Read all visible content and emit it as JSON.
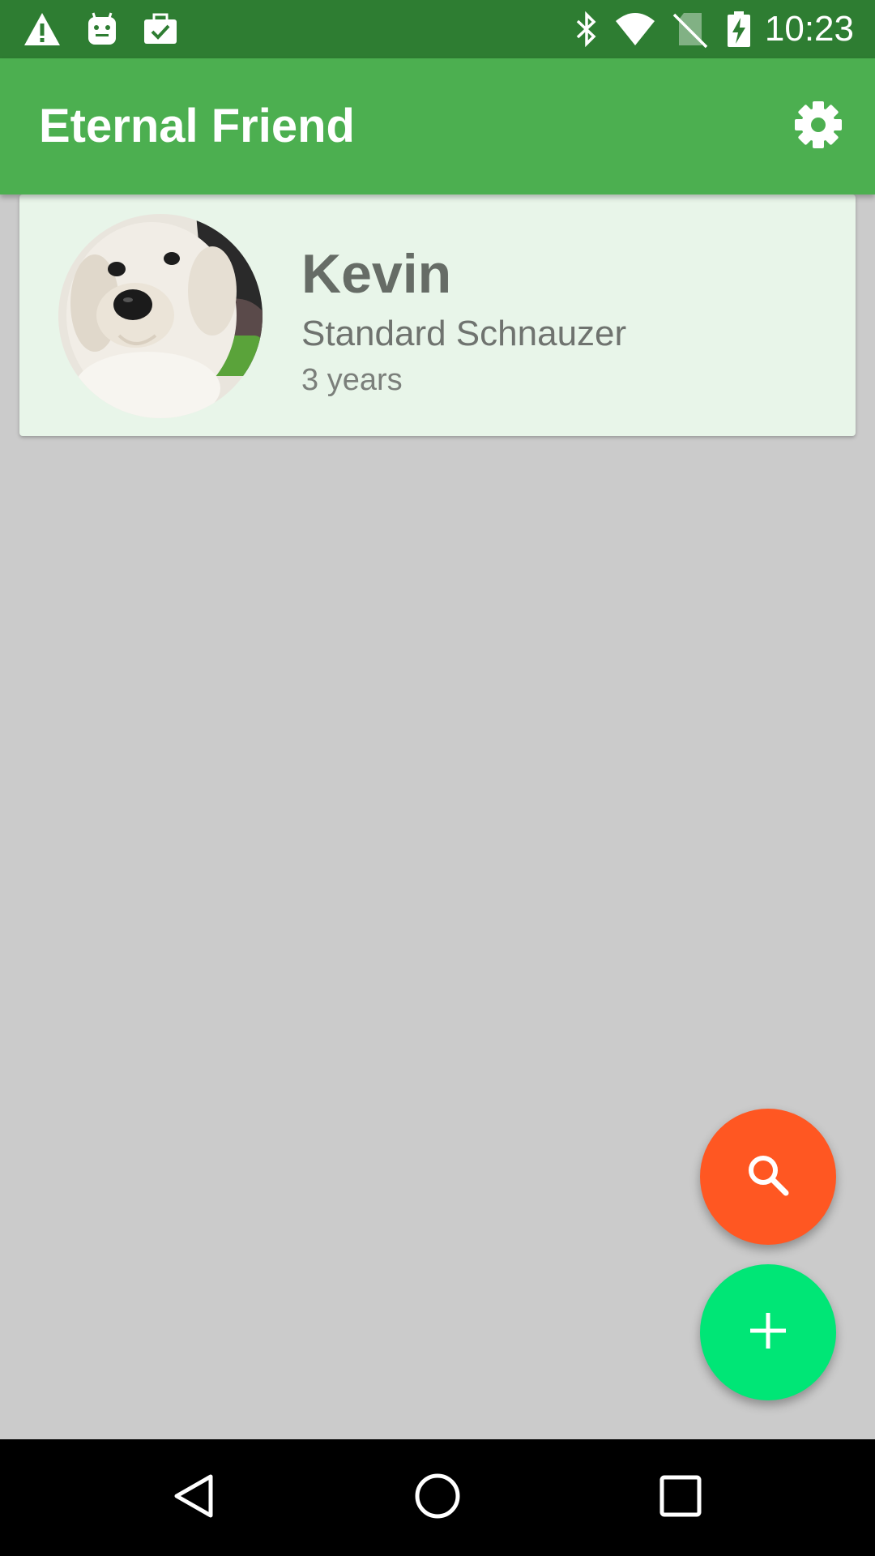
{
  "status_bar": {
    "time": "10:23",
    "left_icons": [
      "warning-icon",
      "android-icon",
      "work-briefcase-icon"
    ],
    "right_icons": [
      "bluetooth-icon",
      "wifi-icon",
      "no-sim-icon",
      "battery-charging-icon"
    ]
  },
  "app_bar": {
    "title": "Eternal Friend",
    "action_icon": "settings-gear-icon"
  },
  "pets": [
    {
      "name": "Kevin",
      "breed": "Standard Schnauzer",
      "age": "3 years",
      "avatar": "dog-photo"
    }
  ],
  "fabs": {
    "search_icon": "search-icon",
    "add_icon": "plus-icon"
  },
  "navigation": {
    "buttons": [
      "back-icon",
      "home-icon",
      "recents-icon"
    ]
  },
  "colors": {
    "status_bar": "#2e7d32",
    "app_bar": "#4caf50",
    "background": "#cbcbcb",
    "card": "#e8f5e9",
    "fab_search": "#ff5722",
    "fab_add": "#00e676",
    "nav_bar": "#000000"
  }
}
